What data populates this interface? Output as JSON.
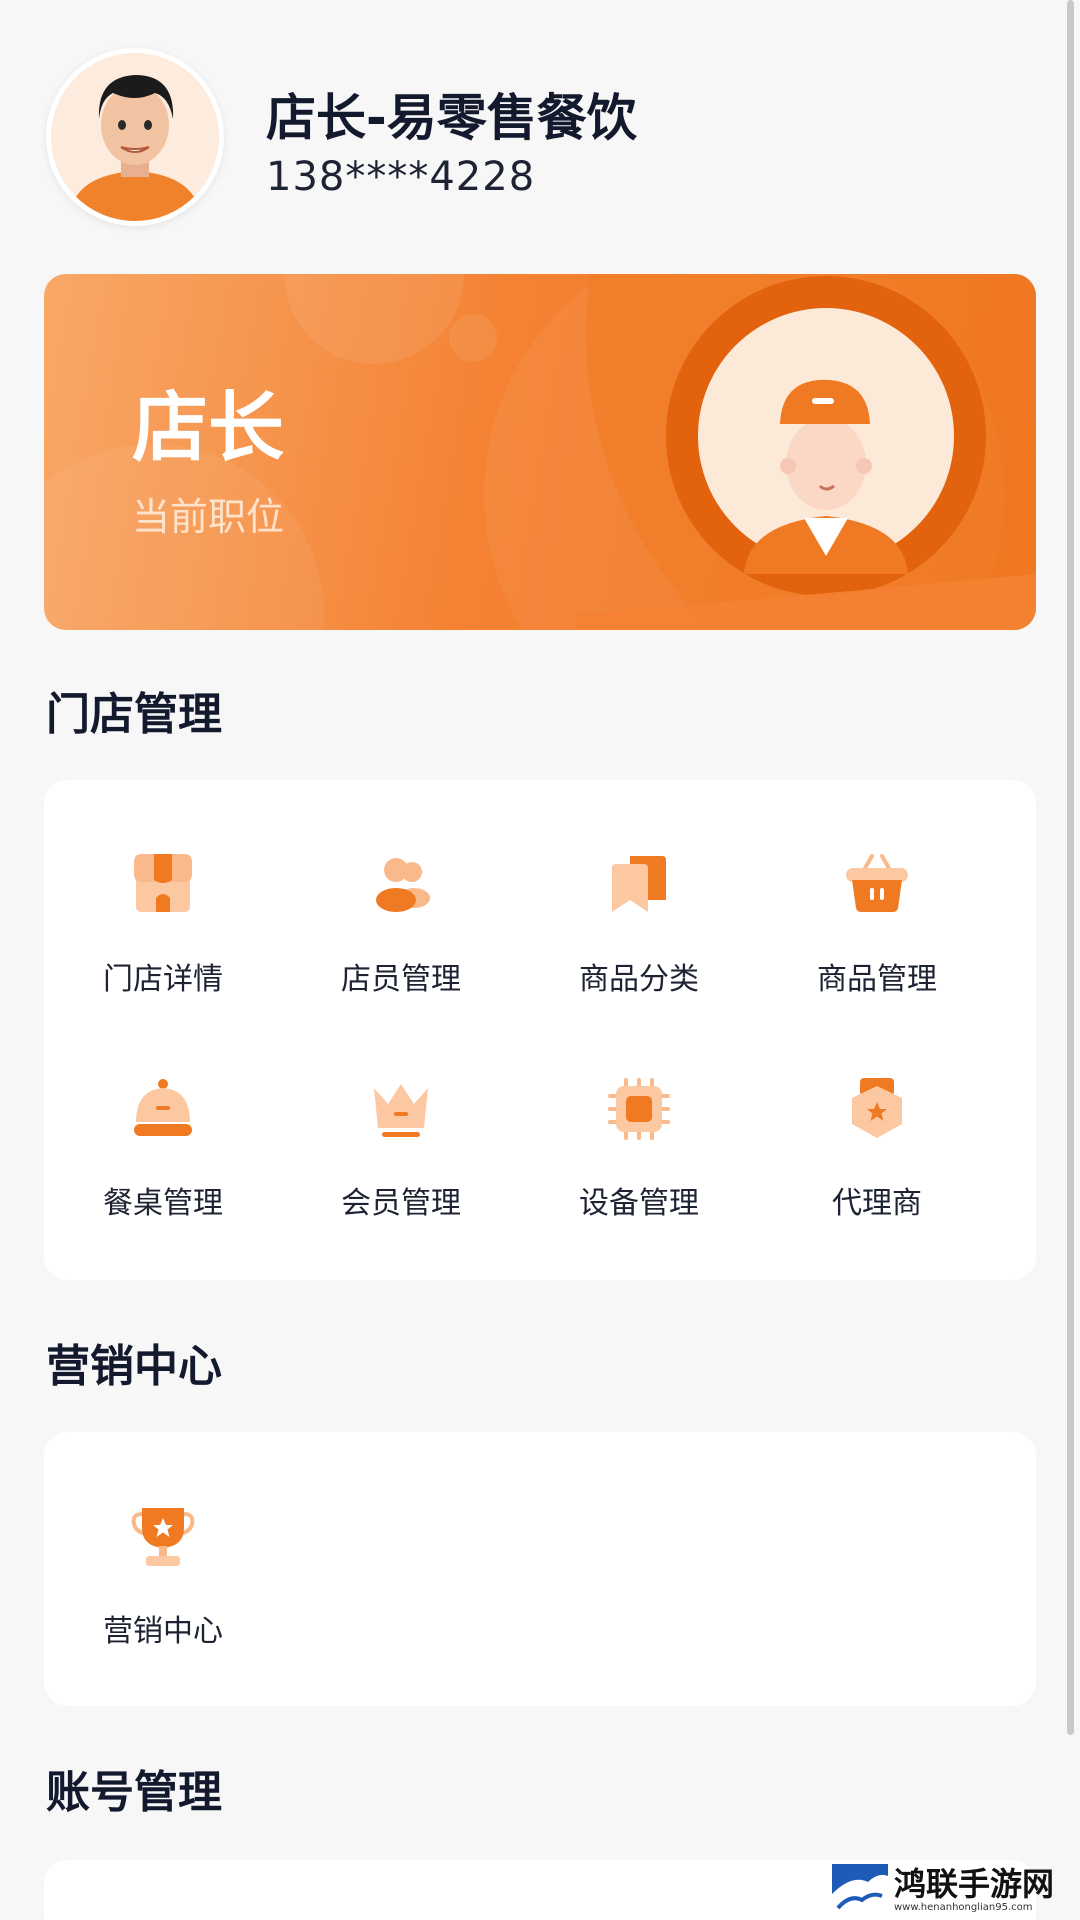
{
  "profile": {
    "store_name": "店长-易零售餐饮",
    "phone": "138****4228"
  },
  "role_card": {
    "title": "店长",
    "subtitle": "当前职位"
  },
  "sections": {
    "store_mgmt": {
      "title": "门店管理",
      "items": [
        {
          "label": "门店详情",
          "icon": "store-icon"
        },
        {
          "label": "店员管理",
          "icon": "staff-icon"
        },
        {
          "label": "商品分类",
          "icon": "category-icon"
        },
        {
          "label": "商品管理",
          "icon": "basket-icon"
        },
        {
          "label": "餐桌管理",
          "icon": "dining-table-icon"
        },
        {
          "label": "会员管理",
          "icon": "crown-icon"
        },
        {
          "label": "设备管理",
          "icon": "chip-icon"
        },
        {
          "label": "代理商",
          "icon": "agent-badge-icon"
        }
      ]
    },
    "marketing": {
      "title": "营销中心",
      "items": [
        {
          "label": "营销中心",
          "icon": "trophy-icon"
        }
      ]
    },
    "account": {
      "title": "账号管理"
    }
  },
  "watermark": {
    "main": "鸿联手游网",
    "sub": "www.henanhonglian95.com"
  },
  "colors": {
    "accent": "#f07a24",
    "accent_light": "#f9b98a",
    "background": "#f7f7f8",
    "card": "#ffffff",
    "text": "#141a2e"
  }
}
